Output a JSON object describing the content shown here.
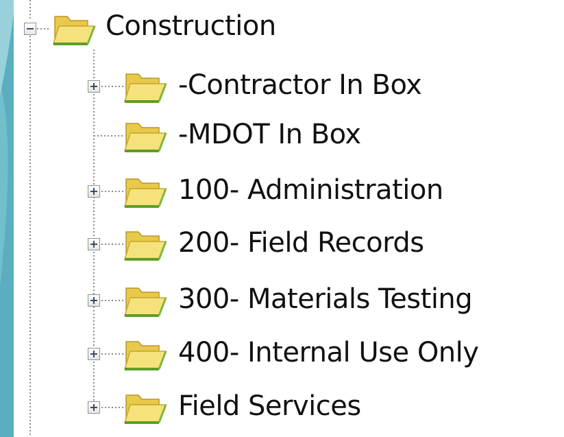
{
  "tree": {
    "root": {
      "label": "Construction",
      "expanded": true,
      "icon": "open-folder-icon"
    },
    "children": [
      {
        "label": "-Contractor In Box",
        "expandable": true,
        "icon": "open-folder-icon"
      },
      {
        "label": "-MDOT In Box",
        "expandable": false,
        "icon": "open-folder-icon"
      },
      {
        "label": "100- Administration",
        "expandable": true,
        "icon": "open-folder-icon"
      },
      {
        "label": "200- Field Records",
        "expandable": true,
        "icon": "open-folder-icon"
      },
      {
        "label": "300- Materials Testing",
        "expandable": true,
        "icon": "open-folder-icon"
      },
      {
        "label": "400- Internal Use Only",
        "expandable": true,
        "icon": "open-folder-icon"
      },
      {
        "label": "Field Services",
        "expandable": true,
        "icon": "open-folder-icon"
      }
    ]
  },
  "colors": {
    "background_teal": "#5cb2c2",
    "panel": "#ffffff",
    "folder_yellow": "#f3dd6b",
    "folder_green_edge": "#6aa52a",
    "tree_line": "#8a8a8a"
  }
}
